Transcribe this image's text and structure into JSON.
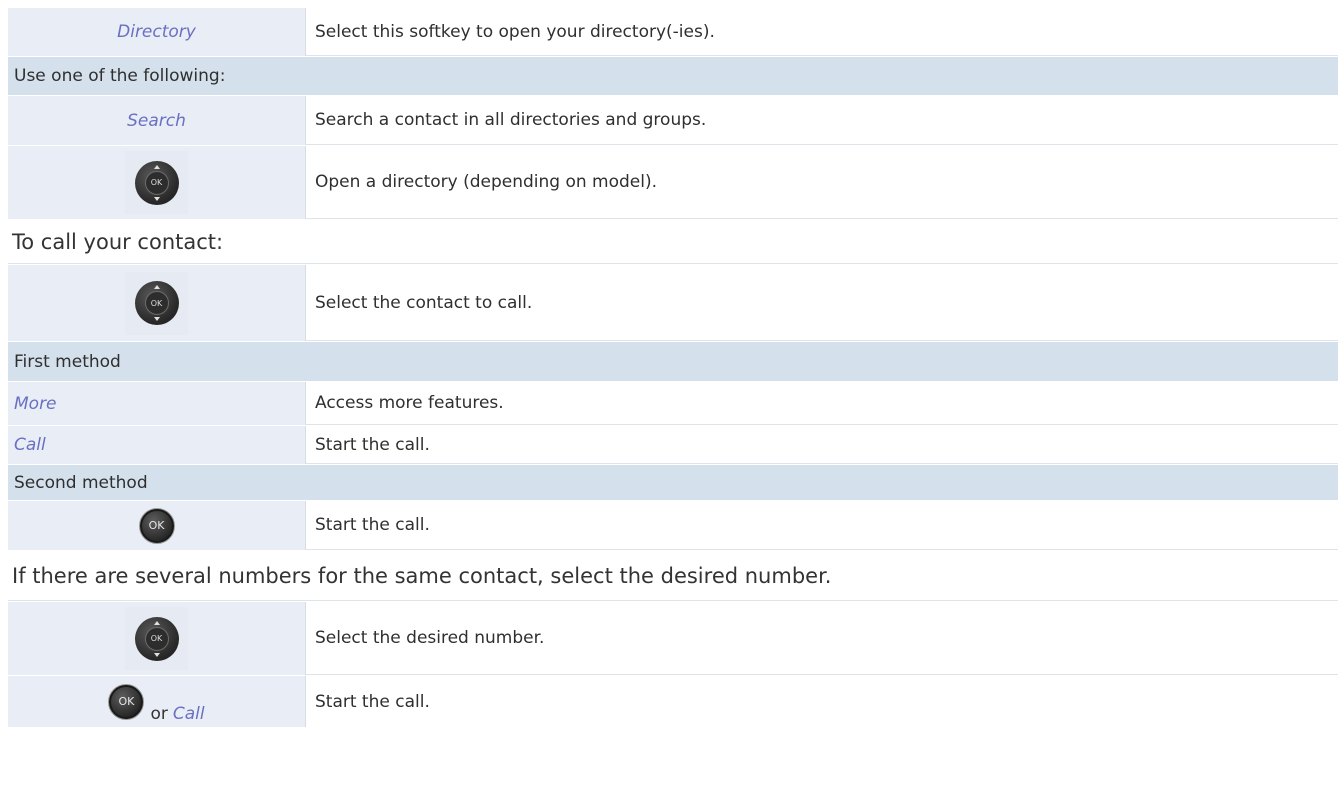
{
  "rows": {
    "r1": {
      "key": "Directory",
      "desc": "Select this softkey to open your directory(-ies)."
    },
    "band1": "Use one of the following:",
    "r2": {
      "key": "Search",
      "desc": "Search a contact in all directories and groups."
    },
    "r3": {
      "icon": "navigator-ok-icon",
      "desc": "Open a directory (depending on model)."
    },
    "heading1": "To call your contact:",
    "r4": {
      "icon": "navigator-ok-icon",
      "desc": "Select the contact to call."
    },
    "band2": "First method",
    "r5": {
      "key": "More",
      "desc": "Access more features."
    },
    "r6": {
      "key": "Call",
      "desc": "Start the call."
    },
    "band3": "Second method",
    "r7": {
      "icon": "ok-key-icon",
      "desc": "Start the call."
    },
    "heading2": "If there are several numbers for the same contact, select the desired number.",
    "r8": {
      "icon": "navigator-ok-icon",
      "desc": "Select the desired number."
    },
    "r9": {
      "icon": "ok-key-icon",
      "or": "or",
      "key": "Call",
      "desc": "Start the call."
    }
  },
  "ok_label": "OK",
  "colors": {
    "band": "#d4e0ec",
    "cell": "#e9edf5",
    "softkey": "#6a6fc2"
  }
}
